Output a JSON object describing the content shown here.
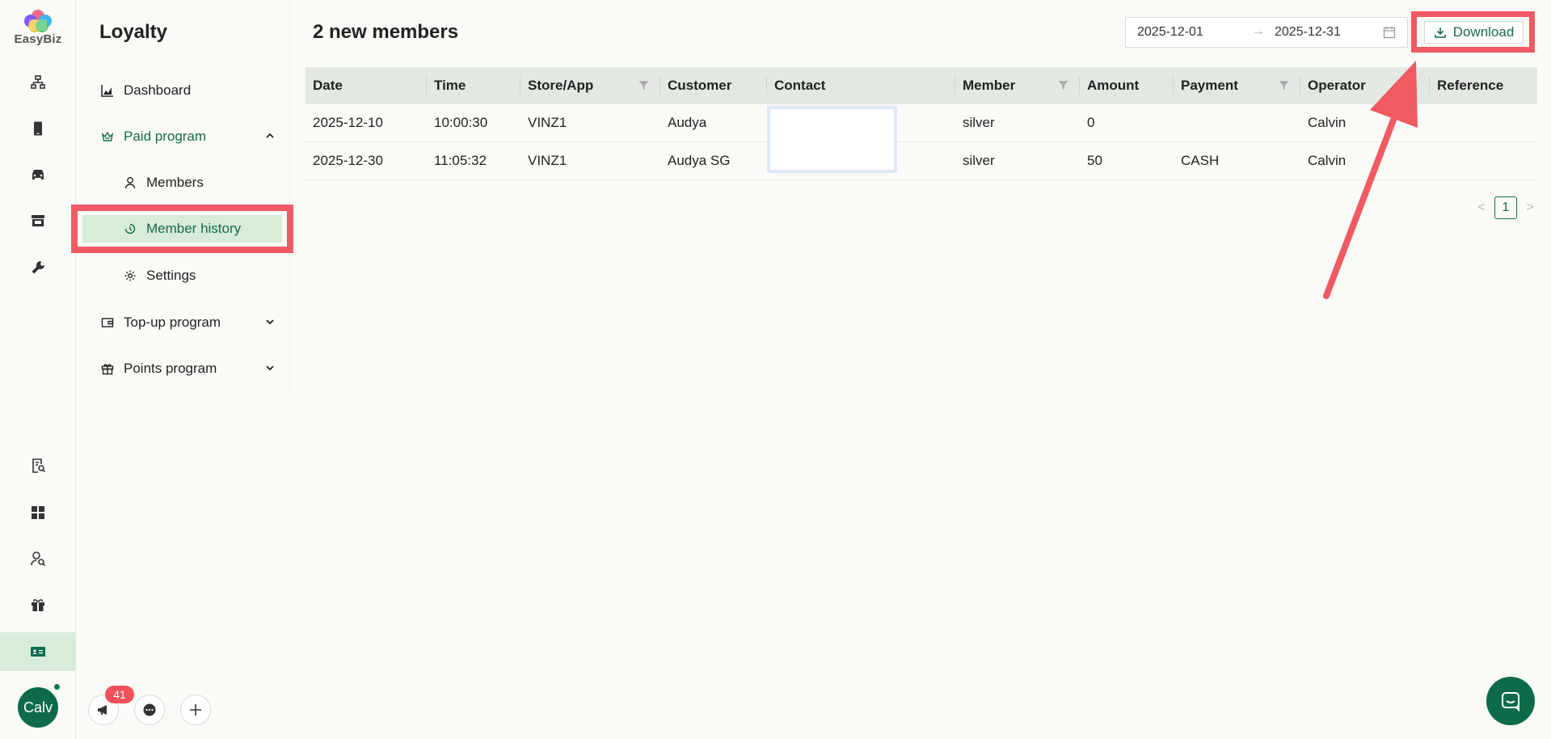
{
  "brand": {
    "name": "EasyBiz"
  },
  "rail": {
    "top_icons": [
      "hierarchy-icon",
      "phone-icon",
      "car-icon",
      "store-icon",
      "wrench-icon"
    ],
    "bottom_icons": [
      "report-search-icon",
      "dashboard-grid-icon",
      "users-search-icon",
      "gift-icon",
      "member-card-icon"
    ],
    "active": "member-card-icon"
  },
  "user": {
    "initials": "Calv",
    "online": true
  },
  "subnav": {
    "title": "Loyalty",
    "items": [
      {
        "label": "Dashboard",
        "icon": "chart-icon"
      },
      {
        "label": "Paid program",
        "icon": "crown-icon",
        "expanded": true
      },
      {
        "label": "Members",
        "icon": "user-icon"
      },
      {
        "label": "Member history",
        "icon": "history-icon",
        "selected": true
      },
      {
        "label": "Settings",
        "icon": "gear-icon"
      },
      {
        "label": "Top-up program",
        "icon": "wallet-icon",
        "expanded": false
      },
      {
        "label": "Points program",
        "icon": "gift-icon",
        "expanded": false
      }
    ]
  },
  "main": {
    "title": "2 new members",
    "date_range": {
      "start": "2025-12-01",
      "separator": "→",
      "end": "2025-12-31"
    },
    "download_label": "Download"
  },
  "table": {
    "columns": [
      "Date",
      "Time",
      "Store/App",
      "Customer",
      "Contact",
      "Member",
      "Amount",
      "Payment",
      "Operator",
      "Reference"
    ],
    "filterable": [
      "Store/App",
      "Member",
      "Payment"
    ],
    "rows": [
      {
        "date": "2025-12-10",
        "time": "10:00:30",
        "store": "VINZ1",
        "customer": "Audya",
        "contact": "",
        "member": "silver",
        "amount": "0",
        "payment": "",
        "operator": "Calvin",
        "reference": ""
      },
      {
        "date": "2025-12-30",
        "time": "11:05:32",
        "store": "VINZ1",
        "customer": "Audya SG",
        "contact": "",
        "member": "silver",
        "amount": "50",
        "payment": "CASH",
        "operator": "Calvin",
        "reference": ""
      }
    ]
  },
  "pagination": {
    "prev": "<",
    "current": "1",
    "next": ">"
  },
  "toolbar": {
    "notification_count": "41"
  },
  "colors": {
    "accent": "#166b4a",
    "highlight": "#f05a62",
    "selected_bg": "#d7ecd9",
    "header_bg": "#e3e9e2"
  }
}
